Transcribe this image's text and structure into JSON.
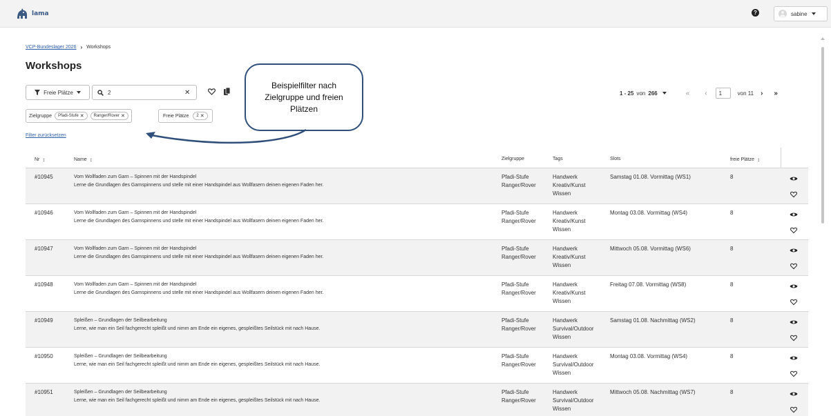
{
  "header": {
    "logo_text": "lama",
    "help_icon": "question-circle-icon",
    "user_name": "sabine"
  },
  "breadcrumb": {
    "parent": "VCP-Bundeslager 2026",
    "current": "Workshops"
  },
  "page": {
    "title": "Workshops"
  },
  "toolbar": {
    "filter_label": "Freie Plätze",
    "search_value": "2",
    "clear_symbol": "✕"
  },
  "filters": {
    "zielgruppe_label": "Zielgruppe",
    "zielgruppe_chips": [
      "Pfadi-Stufe",
      "Ranger/Rover"
    ],
    "freie_label": "Freie Plätze",
    "freie_chip": "2",
    "chip_x": "✕",
    "reset_label": "Filter zurücksetzen"
  },
  "callout": {
    "text": "Beispielfilter nach\nZielgruppe und freien\nPlätzen"
  },
  "pagination": {
    "range": "1 - 25",
    "von_label": "von",
    "total": "266",
    "first": "«",
    "prev": "‹",
    "page": "1",
    "of_pages": "von 11",
    "next": "›",
    "last": "»"
  },
  "table": {
    "headers": {
      "nr": "Nr",
      "name": "Name",
      "zielgruppe": "Zielgruppe",
      "tags": "Tags",
      "slots": "Slots",
      "frei": "freie Plätze",
      "sort_symbol": "↕"
    },
    "rows": [
      {
        "nr": "#10945",
        "title": "Vom Wollfaden zum Garn – Spinnen mit der Handspindel",
        "desc": "Lerne die Grundlagen des Garnspinnens und stelle mit einer Handspindel aus Wollfasern deinen eigenen Faden her.",
        "ziel1": "Pfadi-Stufe",
        "ziel2": "Ranger/Rover",
        "tag1": "Handwerk",
        "tag2": "Kreativ/Kunst",
        "tag3": "Wissen",
        "slot": "Samstag 01.08. Vormittag (WS1)",
        "frei": "8"
      },
      {
        "nr": "#10946",
        "title": "Vom Wollfaden zum Garn – Spinnen mit der Handspindel",
        "desc": "Lerne die Grundlagen des Garnspinnens und stelle mit einer Handspindel aus Wollfasern deinen eigenen Faden her.",
        "ziel1": "Pfadi-Stufe",
        "ziel2": "Ranger/Rover",
        "tag1": "Handwerk",
        "tag2": "Kreativ/Kunst",
        "tag3": "Wissen",
        "slot": "Montag 03.08. Vormittag (WS4)",
        "frei": "8"
      },
      {
        "nr": "#10947",
        "title": "Vom Wollfaden zum Garn – Spinnen mit der Handspindel",
        "desc": "Lerne die Grundlagen des Garnspinnens und stelle mit einer Handspindel aus Wollfasern deinen eigenen Faden her.",
        "ziel1": "Pfadi-Stufe",
        "ziel2": "Ranger/Rover",
        "tag1": "Handwerk",
        "tag2": "Kreativ/Kunst",
        "tag3": "Wissen",
        "slot": "Mittwoch 05.08. Vormittag (WS6)",
        "frei": "8"
      },
      {
        "nr": "#10948",
        "title": "Vom Wollfaden zum Garn – Spinnen mit der Handspindel",
        "desc": "Lerne die Grundlagen des Garnspinnens und stelle mit einer Handspindel aus Wollfasern deinen eigenen Faden her.",
        "ziel1": "Pfadi-Stufe",
        "ziel2": "Ranger/Rover",
        "tag1": "Handwerk",
        "tag2": "Kreativ/Kunst",
        "tag3": "Wissen",
        "slot": "Freitag 07.08. Vormittag (WS8)",
        "frei": "8"
      },
      {
        "nr": "#10949",
        "title": "Spleißen – Grundlagen der Seilbearbeitung",
        "desc": "Lerne, wie man ein Seil fachgerecht spleißt und nimm am Ende ein eigenes, gespleißtes Seilstück mit nach Hause.",
        "ziel1": "Pfadi-Stufe",
        "ziel2": "Ranger/Rover",
        "tag1": "Handwerk",
        "tag2": "Survival/Outdoor",
        "tag3": "Wissen",
        "slot": "Samstag 01.08. Nachmittag (WS2)",
        "frei": "8"
      },
      {
        "nr": "#10950",
        "title": "Spleißen – Grundlagen der Seilbearbeitung",
        "desc": "Lerne, wie man ein Seil fachgerecht spleißt und nimm am Ende ein eigenes, gespleißtes Seilstück mit nach Hause.",
        "ziel1": "Pfadi-Stufe",
        "ziel2": "Ranger/Rover",
        "tag1": "Handwerk",
        "tag2": "Survival/Outdoor",
        "tag3": "Wissen",
        "slot": "Montag 03.08. Vormittag (WS4)",
        "frei": "8"
      },
      {
        "nr": "#10951",
        "title": "Spleißen – Grundlagen der Seilbearbeitung",
        "desc": "Lerne, wie man ein Seil fachgerecht spleißt und nimm am Ende ein eigenes, gespleißtes Seilstück mit nach Hause.",
        "ziel1": "Pfadi-Stufe",
        "ziel2": "Ranger/Rover",
        "tag1": "Handwerk",
        "tag2": "Survival/Outdoor",
        "tag3": "Wissen",
        "slot": "Mittwoch 05.08. Nachmittag (WS7)",
        "frei": "8"
      }
    ]
  },
  "colors": {
    "brand": "#3a5a84",
    "link": "#2d5fa8",
    "callout_border": "#2f4f7a",
    "row_alt": "#f2f2f2"
  }
}
